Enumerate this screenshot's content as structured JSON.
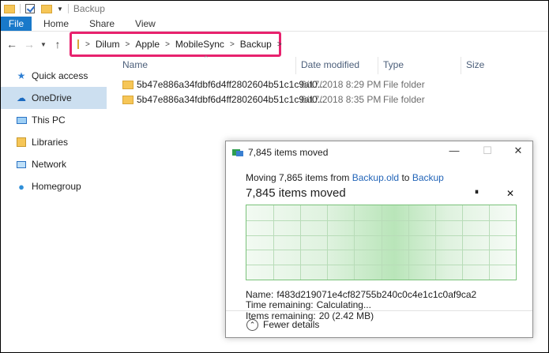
{
  "window": {
    "title": "Backup"
  },
  "ribbon": {
    "tabs": [
      "File",
      "Home",
      "Share",
      "View"
    ]
  },
  "nav": {
    "back_icon": "back-arrow-icon",
    "forward_icon": "forward-arrow-icon",
    "up_icon": "up-arrow-icon"
  },
  "address": {
    "crumbs": [
      "Dilum",
      "Apple",
      "MobileSync",
      "Backup"
    ],
    "highlight_color": "#e8226e"
  },
  "sidebar": {
    "items": [
      {
        "label": "Quick access",
        "icon": "star-icon"
      },
      {
        "label": "OneDrive",
        "icon": "cloud-icon",
        "selected": true
      },
      {
        "label": "This PC",
        "icon": "computer-icon"
      },
      {
        "label": "Libraries",
        "icon": "library-icon"
      },
      {
        "label": "Network",
        "icon": "network-icon"
      },
      {
        "label": "Homegroup",
        "icon": "homegroup-icon"
      }
    ]
  },
  "columns": {
    "name": "Name",
    "date": "Date modified",
    "type": "Type",
    "size": "Size"
  },
  "files": [
    {
      "name": "5b47e886a34fdbf6d4ff2802604b51c1c9af0...",
      "date": "6/17/2018 8:29 PM",
      "type": "File folder"
    },
    {
      "name": "5b47e886a34fdbf6d4ff2802604b51c1c9af0...",
      "date": "6/17/2018 8:35 PM",
      "type": "File folder"
    }
  ],
  "dialog": {
    "title": "7,845 items moved",
    "moving_prefix": "Moving 7,865 items from",
    "source": "Backup.old",
    "to_word": "to",
    "destination": "Backup",
    "status": "7,845 items moved",
    "progress_fraction": 0.997,
    "name_label": "Name:",
    "name_value": "f483d219071e4cf82755b240c0c4e1c1c0af9ca2",
    "time_label": "Time remaining:",
    "time_value": "Calculating...",
    "items_label": "Items remaining:",
    "items_value": "20 (2.42 MB)",
    "fewer_details": "Fewer details",
    "pause_glyph": "⏸",
    "close_glyph": "✕"
  },
  "colors": {
    "file_tab": "#1979ca",
    "selected_item": "#ccdff0",
    "link": "#2365b8",
    "graph": "#7ac27a"
  }
}
